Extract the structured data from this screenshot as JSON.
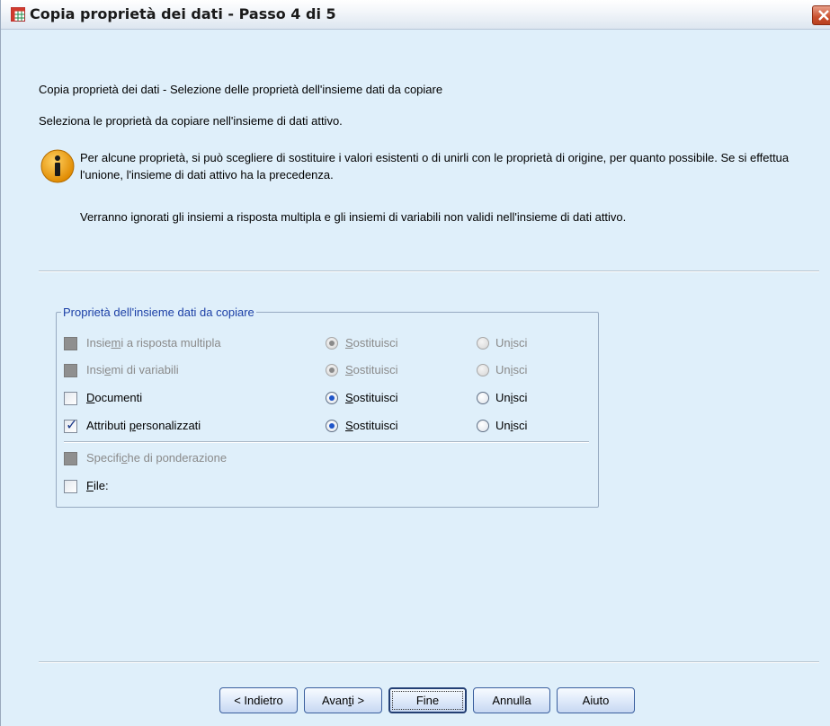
{
  "window": {
    "title": "Copia proprietà dei dati - Passo 4 di 5",
    "app_icon": "spreadsheet-icon",
    "close_icon": "close-icon"
  },
  "content": {
    "heading": "Copia proprietà dei dati - Selezione delle proprietà dell'insieme dati da copiare",
    "instruction": "Seleziona le proprietà da copiare nell'insieme di dati attivo.",
    "info_text": "Per alcune proprietà, si può scegliere di sostituire i valori esistenti o di unirli con le proprietà di origine, per quanto possibile.  Se si effettua l'unione, l'insieme di dati attivo ha la precedenza.",
    "note": "Verranno ignorati gli insiemi a risposta multipla e gli insiemi di variabili non validi nell'insieme di dati attivo.",
    "info_icon": "info-icon"
  },
  "group": {
    "legend": "Proprietà dell'insieme dati da copiare",
    "rows": [
      {
        "label_pre": "Insie",
        "label_u": "m",
        "label_post": "i a risposta multipla",
        "checked": false,
        "disabled": true,
        "replace_pre": "",
        "replace_u": "S",
        "replace_post": "ostituisci",
        "merge_pre": "Un",
        "merge_u": "i",
        "merge_post": "sci",
        "selected": "replace",
        "radio_disabled": true
      },
      {
        "label_pre": "Insi",
        "label_u": "e",
        "label_post": "mi di variabili",
        "checked": false,
        "disabled": true,
        "replace_pre": "",
        "replace_u": "S",
        "replace_post": "ostituisci",
        "merge_pre": "Un",
        "merge_u": "i",
        "merge_post": "sci",
        "selected": "replace",
        "radio_disabled": true
      },
      {
        "label_pre": "",
        "label_u": "D",
        "label_post": "ocumenti",
        "checked": false,
        "disabled": false,
        "replace_pre": "",
        "replace_u": "S",
        "replace_post": "ostituisci",
        "merge_pre": "Un",
        "merge_u": "i",
        "merge_post": "sci",
        "selected": "replace",
        "radio_disabled": false
      },
      {
        "label_pre": "Attributi ",
        "label_u": "p",
        "label_post": "ersonalizzati",
        "checked": true,
        "disabled": false,
        "replace_pre": "",
        "replace_u": "S",
        "replace_post": "ostituisci",
        "merge_pre": "Un",
        "merge_u": "i",
        "merge_post": "sci",
        "selected": "replace",
        "radio_disabled": false
      }
    ],
    "weight": {
      "label_pre": "Specifi",
      "label_u": "c",
      "label_post": "he di ponderazione",
      "checked": false,
      "disabled": true
    },
    "file": {
      "label_pre": "",
      "label_u": "F",
      "label_post": "ile:",
      "checked": false,
      "disabled": false
    }
  },
  "buttons": {
    "back": "< Indietro",
    "next_pre": "Avan",
    "next_u": "t",
    "next_post": "i >",
    "finish": "Fine",
    "cancel": "Annulla",
    "help": "Aiuto"
  },
  "colors": {
    "background": "#dfeffa",
    "legend_text": "#1b3fa6",
    "info_icon": "#f2a20c",
    "radio_selected": "#1f55c9"
  }
}
